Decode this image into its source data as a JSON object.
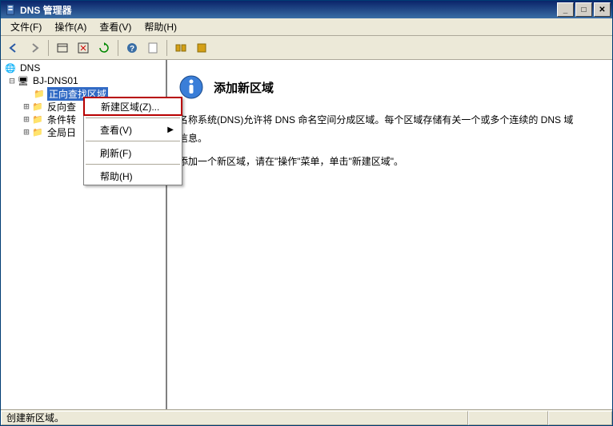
{
  "title": "DNS 管理器",
  "menubar": {
    "file": "文件(F)",
    "action": "操作(A)",
    "view": "查看(V)",
    "help": "帮助(H)"
  },
  "tree": {
    "root": "DNS",
    "server": "BJ-DNS01",
    "forward": "正向查找区域",
    "reverse": "反向查",
    "cond": "条件转",
    "global": "全局日"
  },
  "ctx": {
    "new_zone": "新建区域(Z)...",
    "view": "查看(V)",
    "refresh": "刷新(F)",
    "help": "帮助(H)"
  },
  "content": {
    "heading": "添加新区域",
    "p1": "名称系统(DNS)允许将 DNS 命名空间分成区域。每个区域存储有关一个或多个连续的 DNS 域",
    "p2": "信息。",
    "p3": "添加一个新区域，请在\"操作\"菜单，单击\"新建区域\"。"
  },
  "status": "创建新区域。"
}
